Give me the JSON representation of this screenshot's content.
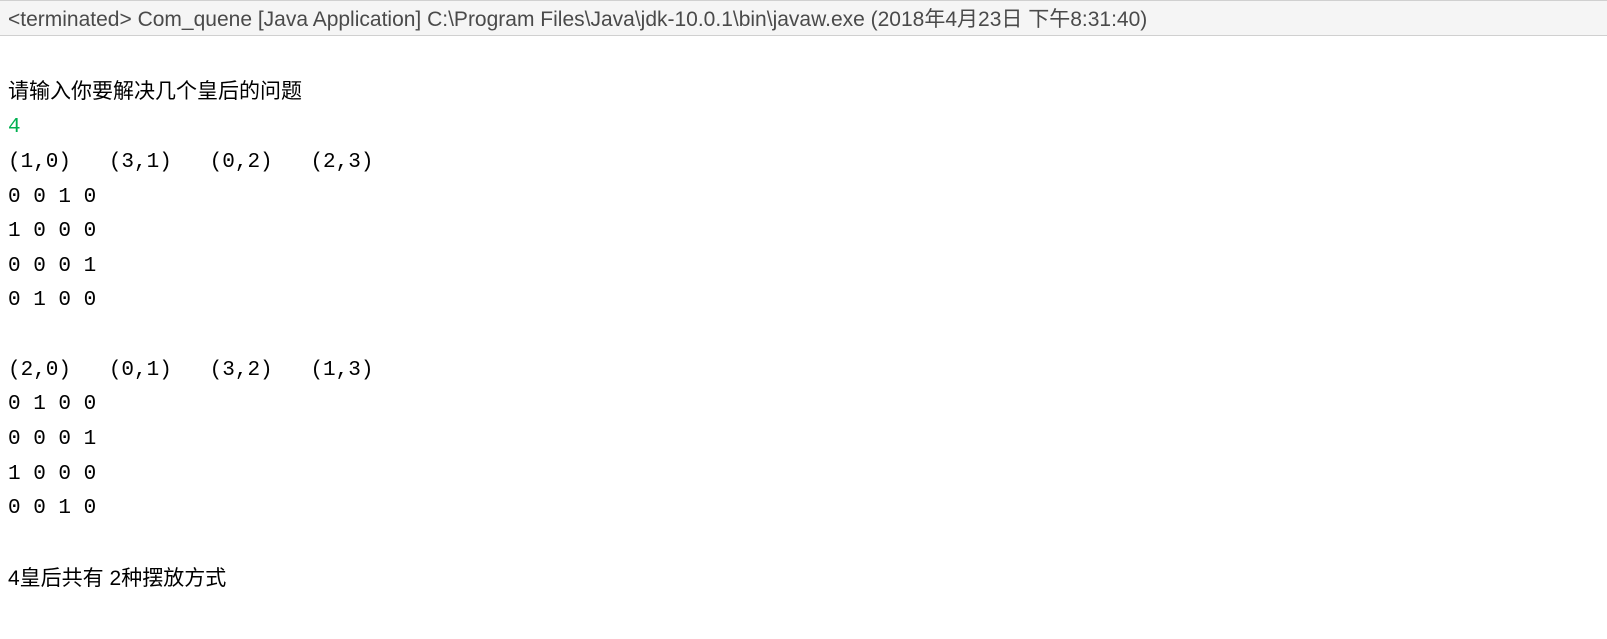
{
  "header": {
    "text": "<terminated> Com_quene [Java Application] C:\\Program Files\\Java\\jdk-10.0.1\\bin\\javaw.exe (2018年4月23日 下午8:31:40)"
  },
  "console": {
    "prompt": "请输入你要解决几个皇后的问题",
    "user_input": "4",
    "solutions": [
      {
        "coords": "(1,0)   (3,1)   (0,2)   (2,3)",
        "board": [
          "0 0 1 0",
          "1 0 0 0",
          "0 0 0 1",
          "0 1 0 0"
        ]
      },
      {
        "coords": "(2,0)   (0,1)   (3,2)   (1,3)",
        "board": [
          "0 1 0 0",
          "0 0 0 1",
          "1 0 0 0",
          "0 0 1 0"
        ]
      }
    ],
    "summary": "4皇后共有 2种摆放方式"
  }
}
